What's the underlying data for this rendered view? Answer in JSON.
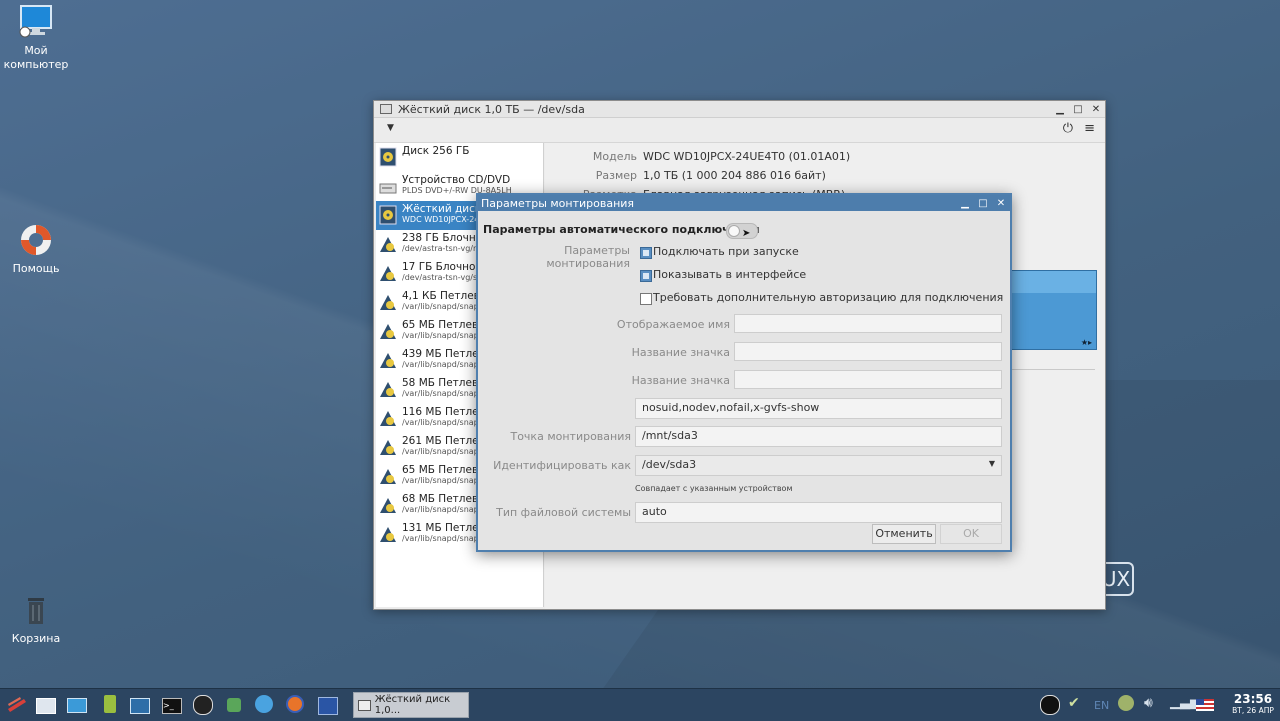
{
  "desktop": {
    "icons": [
      {
        "label1": "Мой",
        "label2": "компьютер"
      },
      {
        "label1": "Помощь"
      },
      {
        "label1": "Корзина"
      }
    ],
    "brand_fragment": "UX"
  },
  "window": {
    "title": "Жёсткий диск 1,0 ТБ — /dev/sda",
    "disks": [
      {
        "name": "Диск 256 ГБ",
        "sub": ""
      },
      {
        "name": "Устройство CD/DVD",
        "sub": "PLDS DVD+/-RW DU-8A5LH"
      },
      {
        "name": "Жёсткий диск 1,0 ТБ",
        "sub": "WDC WD10JPCX-24UE4T0"
      },
      {
        "name": "238 ГБ Блочное устройство",
        "sub": "/dev/astra-tsn-vg/root"
      },
      {
        "name": "17 ГБ Блочное устройство",
        "sub": "/dev/astra-tsn-vg/swap"
      },
      {
        "name": "4,1 КБ Петлевое устройство",
        "sub": "/var/lib/snapd/snaps"
      },
      {
        "name": "65 МБ Петлевое устройство",
        "sub": "/var/lib/snapd/snaps"
      },
      {
        "name": "439 МБ Петлевое устройство",
        "sub": "/var/lib/snapd/snaps"
      },
      {
        "name": "58 МБ Петлевое устройство",
        "sub": "/var/lib/snapd/snaps"
      },
      {
        "name": "116 МБ Петлевое устройство",
        "sub": "/var/lib/snapd/snaps"
      },
      {
        "name": "261 МБ Петлевое устройство",
        "sub": "/var/lib/snapd/snaps"
      },
      {
        "name": "65 МБ Петлевое устройство",
        "sub": "/var/lib/snapd/snaps"
      },
      {
        "name": "68 МБ Петлевое устройство",
        "sub": "/var/lib/snapd/snaps"
      },
      {
        "name": "131 МБ Петлевое устройство",
        "sub": "/var/lib/snapd/snaps"
      }
    ],
    "details": {
      "model_label": "Модель",
      "model_value": "WDC WD10JPCX-24UE4T0 (01.01A01)",
      "size_label": "Размер",
      "size_value": "1,0 ТБ (1 000 204 886 016 байт)",
      "partitioning_label": "Разметка",
      "partitioning_value": "Главная загрузочная запись (MBR)"
    }
  },
  "dialog": {
    "title": "Параметры монтирования",
    "auto_mount_label": "Параметры автоматического подключения",
    "mount_params_label": "Параметры монтирования",
    "opt_startup": "Подключать при запуске",
    "opt_show_ui": "Показывать в интерфейсе",
    "opt_require_auth": "Требовать дополнительную авторизацию для подключения",
    "display_name_label": "Отображаемое имя",
    "display_name_value": "",
    "icon_name_label": "Название значка",
    "icon_name_value": "",
    "symbolic_icon_label": "Название значка",
    "symbolic_icon_value": "",
    "options_value": "nosuid,nodev,nofail,x-gvfs-show",
    "mount_point_label": "Точка монтирования",
    "mount_point_value": "/mnt/sda3",
    "identify_label": "Идентифицировать как",
    "identify_value": "/dev/sda3",
    "match_hint": "Совпадает с указанным устройством",
    "fs_type_label": "Тип файловой системы",
    "fs_type_value": "auto",
    "cancel_label": "Отменить",
    "ok_label": "OK"
  },
  "taskbar": {
    "task_label": "Жёсткий диск 1,0...",
    "lang": "EN",
    "time": "23:56",
    "date": "ВТ, 26 АПР"
  }
}
